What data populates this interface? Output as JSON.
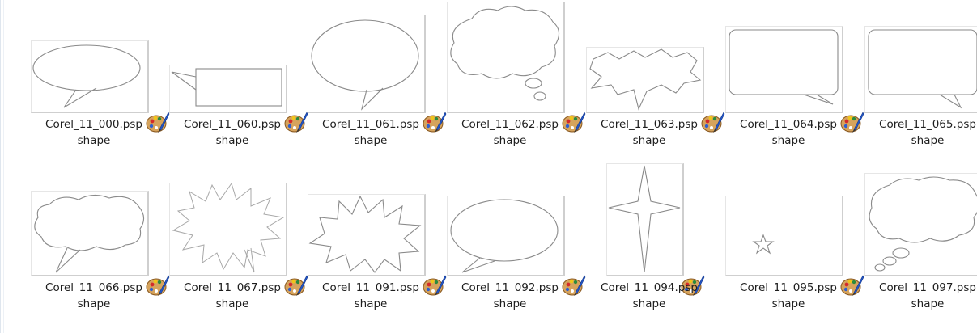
{
  "files": [
    {
      "name": "Corel_11_000.psp",
      "type": "shape",
      "shape": "oval-bubble"
    },
    {
      "name": "Corel_11_060.psp",
      "type": "shape",
      "shape": "rect-callout-left"
    },
    {
      "name": "Corel_11_061.psp",
      "type": "shape",
      "shape": "round-bubble"
    },
    {
      "name": "Corel_11_062.psp",
      "type": "shape",
      "shape": "cloud-thought"
    },
    {
      "name": "Corel_11_063.psp",
      "type": "shape",
      "shape": "jagged-banner"
    },
    {
      "name": "Corel_11_064.psp",
      "type": "shape",
      "shape": "rounded-rect-callout"
    },
    {
      "name": "Corel_11_065.psp",
      "type": "shape",
      "shape": "rounded-rect-callout-2"
    },
    {
      "name": "Corel_11_066.psp",
      "type": "shape",
      "shape": "cloud-speech"
    },
    {
      "name": "Corel_11_067.psp",
      "type": "shape",
      "shape": "burst-light"
    },
    {
      "name": "Corel_11_091.psp",
      "type": "shape",
      "shape": "burst-bold"
    },
    {
      "name": "Corel_11_092.psp",
      "type": "shape",
      "shape": "oval-bubble-2"
    },
    {
      "name": "Corel_11_094.psp",
      "type": "shape",
      "shape": "four-point-star"
    },
    {
      "name": "Corel_11_095.psp",
      "type": "shape",
      "shape": "small-star"
    },
    {
      "name": "Corel_11_097.psp",
      "type": "shape",
      "shape": "cloud-thought-2"
    }
  ],
  "app_icon": "paintshop-palette-icon"
}
